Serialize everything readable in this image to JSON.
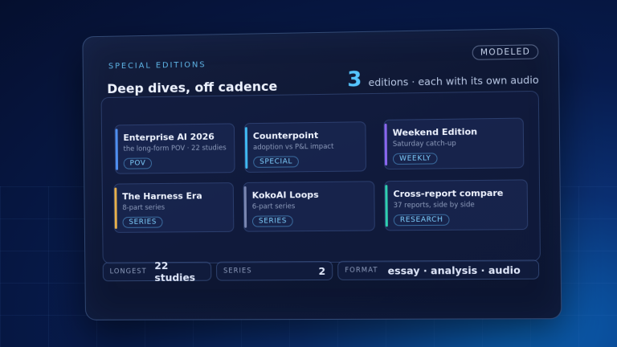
{
  "header": {
    "eyebrow": "SPECIAL EDITIONS",
    "badge": "MODELED",
    "title": "Deep dives, off cadence",
    "count": "3",
    "count_suffix": "editions · each with its own audio"
  },
  "cards": [
    {
      "title": "Enterprise AI 2026",
      "subtitle": "the long-form POV · 22 studies",
      "tag": "POV",
      "accent": "#4f8ff0"
    },
    {
      "title": "Counterpoint",
      "subtitle": "adoption vs P&L impact",
      "tag": "SPECIAL",
      "accent": "#3fb8f0"
    },
    {
      "title": "Weekend Edition",
      "subtitle": "Saturday catch-up",
      "tag": "WEEKLY",
      "accent": "#8a66f0"
    },
    {
      "title": "The Harness Era",
      "subtitle": "8-part series",
      "tag": "SERIES",
      "accent": "#e8b04a"
    },
    {
      "title": "KokoAI Loops",
      "subtitle": "6-part series",
      "tag": "SERIES",
      "accent": "#7a86b0"
    },
    {
      "title": "Cross-report compare",
      "subtitle": "37 reports, side by side",
      "tag": "RESEARCH",
      "accent": "#2fd0b0"
    }
  ],
  "stats": {
    "longest_label": "LONGEST",
    "longest_value": "22 studies",
    "series_label": "SERIES",
    "series_value": "2",
    "format_label": "FORMAT",
    "format_value": "essay · analysis · audio"
  }
}
